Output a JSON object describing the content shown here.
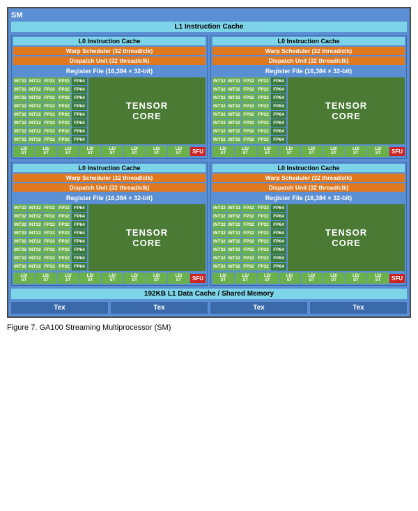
{
  "diagram": {
    "sm_title": "SM",
    "l1_instruction_cache": "L1 Instruction Cache",
    "l0_instruction_cache": "L0 Instruction Cache",
    "warp_scheduler": "Warp Scheduler (32 thread/clk)",
    "dispatch_unit": "Dispatch Unit (32 thread/clk)",
    "register_file": "Register File (16,384 × 32-bit)",
    "tensor_core": "TENSOR CORE",
    "sfu": "SFU",
    "cache_shared_memory": "192KB L1 Data Cache / Shared Memory",
    "tex": "Tex",
    "cuda_rows": [
      [
        "INT32",
        "INT32",
        "FP32",
        "FP32",
        "FP64"
      ],
      [
        "INT32",
        "INT32",
        "FP32",
        "FP32",
        "FP64"
      ],
      [
        "INT32",
        "INT32",
        "FP32",
        "FP32",
        "FP64"
      ],
      [
        "INT32",
        "INT32",
        "FP32",
        "FP32",
        "FP64"
      ],
      [
        "INT32",
        "INT32",
        "FP32",
        "FP32",
        "FP64"
      ],
      [
        "INT32",
        "INT32",
        "FP32",
        "FP32",
        "FP64"
      ],
      [
        "INT32",
        "INT32",
        "FP32",
        "FP32",
        "FP64"
      ],
      [
        "INT32",
        "INT32",
        "FP32",
        "FP32",
        "FP64"
      ]
    ],
    "ld_st_cells": [
      "LD/ST",
      "LD/ST",
      "LD/ST",
      "LD/ST",
      "LD/ST",
      "LD/ST",
      "LD/ST",
      "LD/ST"
    ]
  },
  "caption": "Figure 7.    GA100 Streaming Multiprocessor (SM)"
}
